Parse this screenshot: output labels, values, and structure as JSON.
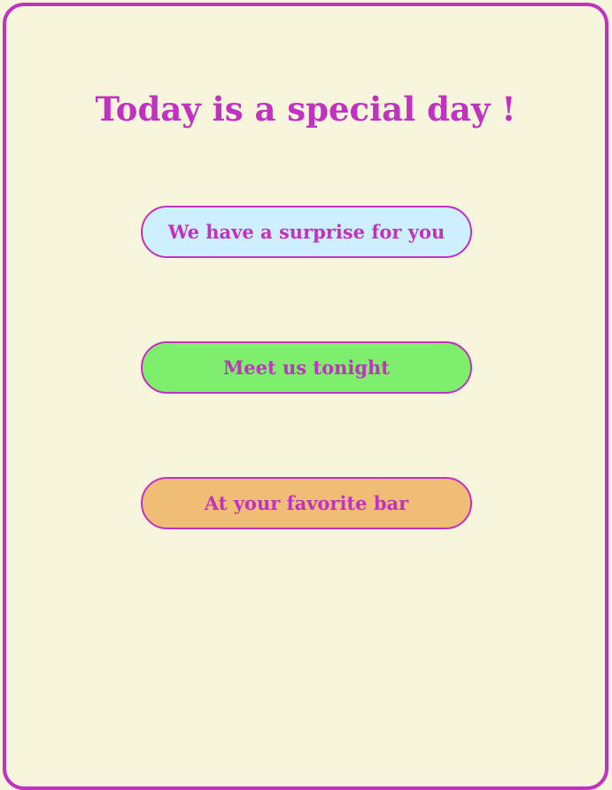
{
  "title": "Today is a special day !",
  "buttons": [
    {
      "label": "We have a surprise for you",
      "color": "#cdefff"
    },
    {
      "label": "Meet us tonight",
      "color": "#7def6c"
    },
    {
      "label": "At your favorite bar",
      "color": "#efbd75"
    }
  ],
  "colors": {
    "accent": "#c232c0",
    "background": "#f7f5dc"
  }
}
